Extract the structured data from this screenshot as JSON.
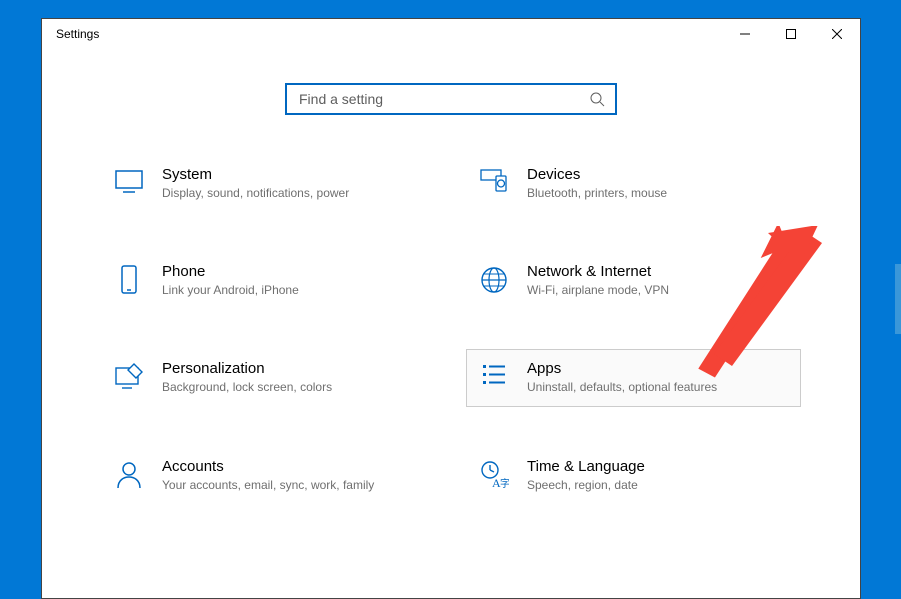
{
  "window_title": "Settings",
  "search": {
    "placeholder": "Find a setting"
  },
  "tiles": {
    "system": {
      "title": "System",
      "desc": "Display, sound, notifications, power"
    },
    "devices": {
      "title": "Devices",
      "desc": "Bluetooth, printers, mouse"
    },
    "phone": {
      "title": "Phone",
      "desc": "Link your Android, iPhone"
    },
    "network": {
      "title": "Network & Internet",
      "desc": "Wi-Fi, airplane mode, VPN"
    },
    "personalization": {
      "title": "Personalization",
      "desc": "Background, lock screen, colors"
    },
    "apps": {
      "title": "Apps",
      "desc": "Uninstall, defaults, optional features"
    },
    "accounts": {
      "title": "Accounts",
      "desc": "Your accounts, email, sync, work, family"
    },
    "time": {
      "title": "Time & Language",
      "desc": "Speech, region, date"
    }
  },
  "colors": {
    "accent": "#0067c0",
    "arrow": "#f44336"
  }
}
